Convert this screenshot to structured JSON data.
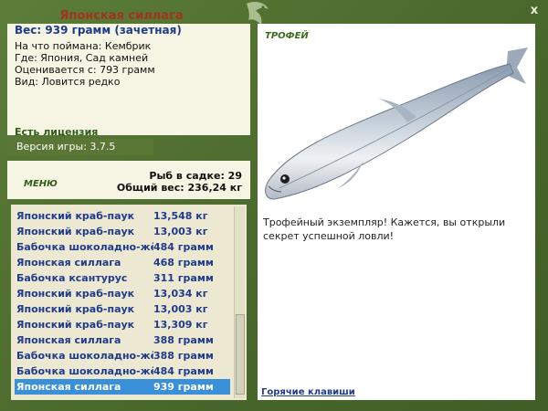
{
  "window": {
    "close_label": "x"
  },
  "fish": {
    "title": "Японская силлага",
    "weight": "Вес: 939 грамм (зачетная)",
    "bait": "На что поймана: Кембрик",
    "location": "Где: Япония, Сад камней",
    "valued_from": "Оценивается с: 793 грамм",
    "type": "Вид: Ловится редко"
  },
  "license": "Есть лицензия",
  "version": "Версия игры: 3.7.5",
  "menu_label": "МЕНЮ",
  "stats": {
    "fish_in_keepnet": "Рыб в садке: 29",
    "total_weight": "Общий вес: 236,24 кг"
  },
  "catch_list": [
    {
      "name": "Японский краб-паук",
      "weight": "13,548 кг"
    },
    {
      "name": "Японский краб-паук",
      "weight": "13,003 кг"
    },
    {
      "name": "Бабочка шоколадно-жё...",
      "weight": "484 грамм"
    },
    {
      "name": "Японская силлага",
      "weight": "468 грамм"
    },
    {
      "name": "Бабочка ксантурус",
      "weight": "311 грамм"
    },
    {
      "name": "Японский краб-паук",
      "weight": "13,034 кг"
    },
    {
      "name": "Японский краб-паук",
      "weight": "13,003 кг"
    },
    {
      "name": "Японский краб-паук",
      "weight": "13,309 кг"
    },
    {
      "name": "Японская силлага",
      "weight": "388 грамм"
    },
    {
      "name": "Бабочка шоколадно-жё...",
      "weight": "388 грамм"
    },
    {
      "name": "Бабочка шоколадно-жё...",
      "weight": "484 грамм"
    },
    {
      "name": "Японская силлага",
      "weight": "939 грамм"
    }
  ],
  "selected_index": 11,
  "trophy": {
    "title": "ТРОФЕЙ",
    "text": "Трофейный экземпляр! Кажется, вы открыли секрет успешной ловли!"
  },
  "hotkeys_label": "Горячие клавиши",
  "colors": {
    "frame": "#4f6b33",
    "title_red": "#a0341d",
    "list_blue": "#1f3b8a",
    "selected": "#3a90d8"
  }
}
